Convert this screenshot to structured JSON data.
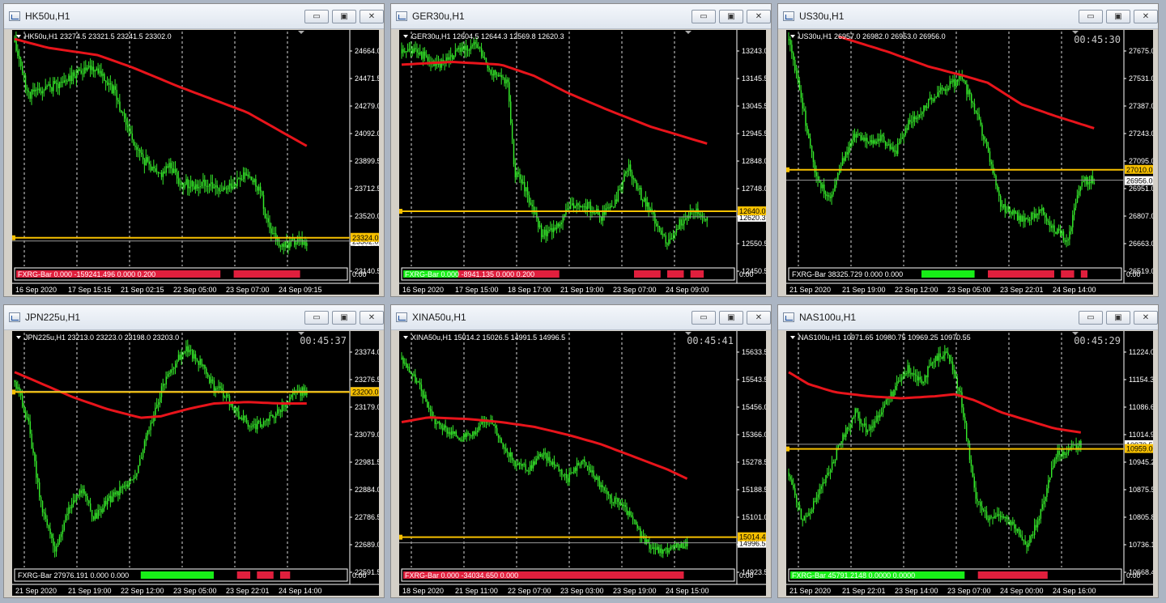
{
  "theme": {
    "candle": "#35e82a",
    "ma": "#e8141b",
    "hline": "#f7c000",
    "grid": "#ffffff",
    "bar_red": "#e01f3d",
    "bar_green": "#18ee18"
  },
  "window_buttons": {
    "minimize": "▭",
    "maximize": "▣",
    "close": "✕"
  },
  "charts": [
    {
      "id": "hk50",
      "window_title": "HK50u,H1",
      "header": "HK50u,H1  23274.5 23321.5 23241.5 23302.0",
      "timer": "",
      "price_ticks": [
        "24664.0",
        "24471.5",
        "24279.0",
        "24092.0",
        "23899.5",
        "23712.5",
        "23520.0",
        "23327.5",
        "23140.5"
      ],
      "time_labels": [
        "16 Sep 2020",
        "17 Sep 15:15",
        "21 Sep 02:15",
        "22 Sep 05:00",
        "23 Sep 07:00",
        "24 Sep 09:15"
      ],
      "ask_label": "23324.0",
      "bid_label": "23302.0",
      "indicator_label": "FXRG-Bar 0.000 -159241.496 0.000 0.200",
      "indicator_scale": "0.00",
      "ymin": 23140.5,
      "ymax": 24664.0,
      "ask": 23324.0,
      "bid": 23302.0,
      "path": [
        [
          0,
          24660
        ],
        [
          0.04,
          24300
        ],
        [
          0.08,
          24330
        ],
        [
          0.14,
          24380
        ],
        [
          0.2,
          24470
        ],
        [
          0.25,
          24480
        ],
        [
          0.3,
          24320
        ],
        [
          0.34,
          24080
        ],
        [
          0.38,
          23880
        ],
        [
          0.43,
          23750
        ],
        [
          0.47,
          23820
        ],
        [
          0.5,
          23700
        ],
        [
          0.54,
          23680
        ],
        [
          0.58,
          23710
        ],
        [
          0.62,
          23620
        ],
        [
          0.66,
          23700
        ],
        [
          0.7,
          23750
        ],
        [
          0.74,
          23640
        ],
        [
          0.76,
          23420
        ],
        [
          0.8,
          23260
        ],
        [
          0.84,
          23290
        ],
        [
          0.88,
          23290
        ]
      ],
      "ma": [
        [
          0,
          24680
        ],
        [
          0.1,
          24620
        ],
        [
          0.25,
          24570
        ],
        [
          0.35,
          24490
        ],
        [
          0.5,
          24350
        ],
        [
          0.7,
          24180
        ],
        [
          0.88,
          23950
        ]
      ],
      "candles": 190,
      "vol": 70,
      "seed": 11,
      "bars": [
        {
          "a": 0.005,
          "b": 0.62,
          "c": "red"
        },
        {
          "a": 0.66,
          "b": 0.86,
          "c": "red"
        }
      ]
    },
    {
      "id": "ger30",
      "window_title": "GER30u,H1",
      "header": "GER30u,H1  12604.5 12644.3 12569.8 12620.3",
      "timer": "",
      "price_ticks": [
        "13243.0",
        "13145.5",
        "13045.5",
        "12945.5",
        "12848.0",
        "12748.0",
        "12650.5",
        "12550.5",
        "12450.5"
      ],
      "time_labels": [
        "16 Sep 2020",
        "17 Sep 15:00",
        "18 Sep 17:00",
        "21 Sep 19:00",
        "23 Sep 07:00",
        "24 Sep 09:00"
      ],
      "ask_label": "12640.0",
      "bid_label": "12620.3",
      "indicator_label": "FXRG-Bar 0.000 -8941.135 0.000 0.200",
      "indicator_scale": "0.00",
      "ymin": 12450.5,
      "ymax": 13243.0,
      "ask": 12640.0,
      "bid": 12620.3,
      "path": [
        [
          0,
          13200
        ],
        [
          0.05,
          13210
        ],
        [
          0.1,
          13150
        ],
        [
          0.16,
          13200
        ],
        [
          0.22,
          13240
        ],
        [
          0.27,
          13140
        ],
        [
          0.32,
          13090
        ],
        [
          0.34,
          12780
        ],
        [
          0.38,
          12700
        ],
        [
          0.42,
          12560
        ],
        [
          0.46,
          12580
        ],
        [
          0.5,
          12650
        ],
        [
          0.56,
          12660
        ],
        [
          0.6,
          12620
        ],
        [
          0.64,
          12660
        ],
        [
          0.68,
          12800
        ],
        [
          0.72,
          12700
        ],
        [
          0.76,
          12620
        ],
        [
          0.8,
          12520
        ],
        [
          0.84,
          12600
        ],
        [
          0.88,
          12640
        ],
        [
          0.92,
          12620
        ]
      ],
      "ma": [
        [
          0,
          13160
        ],
        [
          0.15,
          13170
        ],
        [
          0.3,
          13160
        ],
        [
          0.4,
          13120
        ],
        [
          0.5,
          13060
        ],
        [
          0.62,
          13000
        ],
        [
          0.75,
          12940
        ],
        [
          0.92,
          12880
        ]
      ],
      "candles": 200,
      "vol": 35,
      "seed": 23,
      "bars": [
        {
          "a": 0.005,
          "b": 0.17,
          "c": "green"
        },
        {
          "a": 0.17,
          "b": 0.475,
          "c": "red"
        },
        {
          "a": 0.7,
          "b": 0.78,
          "c": "red"
        },
        {
          "a": 0.8,
          "b": 0.85,
          "c": "red"
        },
        {
          "a": 0.87,
          "b": 0.91,
          "c": "red"
        }
      ]
    },
    {
      "id": "us30",
      "window_title": "US30u,H1",
      "header": "US30u,H1  26957.0 26982.0 26953.0 26956.0",
      "timer": "00:45:30",
      "price_ticks": [
        "27675.0",
        "27531.0",
        "27387.0",
        "27243.0",
        "27095.0",
        "26951.0",
        "26807.0",
        "26663.0",
        "26519.0"
      ],
      "time_labels": [
        "21 Sep 2020",
        "21 Sep 19:00",
        "22 Sep 12:00",
        "23 Sep 05:00",
        "23 Sep 22:01",
        "24 Sep 14:00"
      ],
      "ask_label": "27010.0",
      "bid_label": "26956.0",
      "indicator_label": "FXRG-Bar 38325.729 0.000 0.000",
      "indicator_scale": "0.00",
      "ymin": 26519.0,
      "ymax": 27675.0,
      "ask": 27010.0,
      "bid": 26956.0,
      "path": [
        [
          0,
          27680
        ],
        [
          0.04,
          27350
        ],
        [
          0.08,
          27000
        ],
        [
          0.12,
          26850
        ],
        [
          0.16,
          27050
        ],
        [
          0.2,
          27200
        ],
        [
          0.24,
          27150
        ],
        [
          0.28,
          27180
        ],
        [
          0.32,
          27100
        ],
        [
          0.36,
          27250
        ],
        [
          0.4,
          27320
        ],
        [
          0.46,
          27430
        ],
        [
          0.52,
          27480
        ],
        [
          0.56,
          27330
        ],
        [
          0.6,
          27100
        ],
        [
          0.64,
          26820
        ],
        [
          0.7,
          26750
        ],
        [
          0.76,
          26800
        ],
        [
          0.8,
          26700
        ],
        [
          0.84,
          26650
        ],
        [
          0.88,
          26950
        ],
        [
          0.92,
          26960
        ]
      ],
      "ma": [
        [
          0.15,
          27700
        ],
        [
          0.3,
          27620
        ],
        [
          0.42,
          27545
        ],
        [
          0.52,
          27500
        ],
        [
          0.6,
          27460
        ],
        [
          0.7,
          27350
        ],
        [
          0.8,
          27290
        ],
        [
          0.92,
          27225
        ]
      ],
      "candles": 200,
      "vol": 45,
      "seed": 37,
      "bars": [
        {
          "a": 0.4,
          "b": 0.56,
          "c": "green"
        },
        {
          "a": 0.6,
          "b": 0.8,
          "c": "red"
        },
        {
          "a": 0.82,
          "b": 0.86,
          "c": "red"
        },
        {
          "a": 0.88,
          "b": 0.9,
          "c": "red"
        }
      ]
    },
    {
      "id": "jpn225",
      "window_title": "JPN225u,H1",
      "header": "JPN225u,H1  23213.0 23223.0 23198.0 23203.0",
      "timer": "00:45:37",
      "price_ticks": [
        "23374.0",
        "23276.5",
        "23179.0",
        "23079.0",
        "22981.5",
        "22884.0",
        "22786.5",
        "22689.0",
        "22591.5"
      ],
      "time_labels": [
        "21 Sep 2020",
        "21 Sep 19:00",
        "22 Sep 12:00",
        "23 Sep 05:00",
        "23 Sep 22:01",
        "24 Sep 14:00"
      ],
      "ask_label": "23200.0",
      "bid_label": "23203.0",
      "indicator_label": "FXRG-Bar 27976.191 0.000 0.000",
      "indicator_scale": "0.00",
      "ymin": 22591.5,
      "ymax": 23374.0,
      "ask": 23200.0,
      "bid": 23203.0,
      "path": [
        [
          0,
          23240
        ],
        [
          0.04,
          23100
        ],
        [
          0.08,
          22800
        ],
        [
          0.12,
          22650
        ],
        [
          0.16,
          22780
        ],
        [
          0.2,
          22860
        ],
        [
          0.24,
          22760
        ],
        [
          0.28,
          22820
        ],
        [
          0.32,
          22860
        ],
        [
          0.36,
          22900
        ],
        [
          0.4,
          23050
        ],
        [
          0.44,
          23200
        ],
        [
          0.48,
          23300
        ],
        [
          0.52,
          23350
        ],
        [
          0.56,
          23300
        ],
        [
          0.6,
          23220
        ],
        [
          0.64,
          23180
        ],
        [
          0.68,
          23110
        ],
        [
          0.72,
          23080
        ],
        [
          0.76,
          23100
        ],
        [
          0.8,
          23140
        ],
        [
          0.84,
          23200
        ],
        [
          0.88,
          23203
        ]
      ],
      "ma": [
        [
          0,
          23270
        ],
        [
          0.08,
          23230
        ],
        [
          0.18,
          23180
        ],
        [
          0.28,
          23140
        ],
        [
          0.38,
          23110
        ],
        [
          0.44,
          23115
        ],
        [
          0.52,
          23140
        ],
        [
          0.6,
          23160
        ],
        [
          0.7,
          23165
        ],
        [
          0.8,
          23160
        ],
        [
          0.88,
          23160
        ]
      ],
      "candles": 190,
      "vol": 30,
      "seed": 51,
      "bars": [
        {
          "a": 0.38,
          "b": 0.6,
          "c": "green"
        },
        {
          "a": 0.67,
          "b": 0.71,
          "c": "red"
        },
        {
          "a": 0.73,
          "b": 0.78,
          "c": "red"
        },
        {
          "a": 0.8,
          "b": 0.83,
          "c": "red"
        }
      ]
    },
    {
      "id": "xina50",
      "window_title": "XINA50u,H1",
      "header": "XINA50u,H1  15014.2 15026.5 14991.5 14996.5",
      "timer": "00:45:41",
      "price_ticks": [
        "15633.5",
        "15543.5",
        "15456.0",
        "15366.0",
        "15278.5",
        "15188.5",
        "15101.0",
        "15011.0",
        "14923.5"
      ],
      "time_labels": [
        "18 Sep 2020",
        "21 Sep 11:00",
        "22 Sep 07:00",
        "23 Sep 03:00",
        "23 Sep 19:00",
        "24 Sep 15:00"
      ],
      "ask_label": "15014.4",
      "bid_label": "14996.5",
      "indicator_label": "FXRG-Bar 0.000 -34034.650 0.000",
      "indicator_scale": "0.00",
      "ymin": 14923.5,
      "ymax": 15633.5,
      "ask": 15014.4,
      "bid": 14996.5,
      "path": [
        [
          0,
          15580
        ],
        [
          0.05,
          15500
        ],
        [
          0.1,
          15380
        ],
        [
          0.14,
          15350
        ],
        [
          0.18,
          15330
        ],
        [
          0.22,
          15340
        ],
        [
          0.26,
          15400
        ],
        [
          0.3,
          15320
        ],
        [
          0.34,
          15250
        ],
        [
          0.38,
          15230
        ],
        [
          0.42,
          15280
        ],
        [
          0.46,
          15250
        ],
        [
          0.5,
          15200
        ],
        [
          0.54,
          15260
        ],
        [
          0.58,
          15210
        ],
        [
          0.62,
          15140
        ],
        [
          0.66,
          15120
        ],
        [
          0.7,
          15060
        ],
        [
          0.74,
          14990
        ],
        [
          0.78,
          14970
        ],
        [
          0.82,
          14980
        ],
        [
          0.86,
          14995
        ]
      ],
      "ma": [
        [
          0,
          15380
        ],
        [
          0.08,
          15395
        ],
        [
          0.2,
          15390
        ],
        [
          0.3,
          15380
        ],
        [
          0.4,
          15365
        ],
        [
          0.5,
          15340
        ],
        [
          0.6,
          15310
        ],
        [
          0.7,
          15270
        ],
        [
          0.8,
          15230
        ],
        [
          0.86,
          15200
        ]
      ],
      "candles": 190,
      "vol": 25,
      "seed": 67,
      "bars": [
        {
          "a": 0.005,
          "b": 0.85,
          "c": "red"
        }
      ]
    },
    {
      "id": "nas100",
      "window_title": "NAS100u,H1",
      "header": "NAS100u,H1  10971.65 10980.75 10969.25 10970.55",
      "timer": "00:45:29",
      "price_ticks": [
        "11224.00",
        "11154.30",
        "11086.60",
        "11014.90",
        "10945.20",
        "10875.50",
        "10805.80",
        "10736.10",
        "10668.45"
      ],
      "time_labels": [
        "21 Sep 2020",
        "21 Sep 22:01",
        "23 Sep 14:00",
        "23 Sep 07:00",
        "24 Sep 00:00",
        "24 Sep 16:00"
      ],
      "ask_label": "10959.00",
      "bid_label": "10970.55",
      "indicator_label": "FXRG-Bar 45791.2148 0.0000 0.0000",
      "indicator_scale": "0.00",
      "ymin": 10668.45,
      "ymax": 11224.0,
      "ask": 10959.0,
      "bid": 10970.55,
      "path": [
        [
          0,
          10900
        ],
        [
          0.04,
          10780
        ],
        [
          0.08,
          10830
        ],
        [
          0.12,
          10900
        ],
        [
          0.16,
          10980
        ],
        [
          0.2,
          11050
        ],
        [
          0.24,
          11000
        ],
        [
          0.28,
          11060
        ],
        [
          0.32,
          11110
        ],
        [
          0.36,
          11160
        ],
        [
          0.4,
          11130
        ],
        [
          0.44,
          11180
        ],
        [
          0.48,
          11200
        ],
        [
          0.52,
          11080
        ],
        [
          0.56,
          10850
        ],
        [
          0.6,
          10780
        ],
        [
          0.64,
          10800
        ],
        [
          0.68,
          10760
        ],
        [
          0.72,
          10720
        ],
        [
          0.76,
          10800
        ],
        [
          0.8,
          10940
        ],
        [
          0.84,
          10960
        ],
        [
          0.88,
          10970
        ]
      ],
      "ma": [
        [
          0,
          11150
        ],
        [
          0.06,
          11120
        ],
        [
          0.14,
          11100
        ],
        [
          0.24,
          11090
        ],
        [
          0.34,
          11085
        ],
        [
          0.44,
          11090
        ],
        [
          0.5,
          11095
        ],
        [
          0.56,
          11080
        ],
        [
          0.64,
          11050
        ],
        [
          0.72,
          11030
        ],
        [
          0.8,
          11010
        ],
        [
          0.88,
          11000
        ]
      ],
      "candles": 190,
      "vol": 22,
      "seed": 83,
      "bars": [
        {
          "a": 0.005,
          "b": 0.53,
          "c": "green"
        },
        {
          "a": 0.57,
          "b": 0.78,
          "c": "red"
        }
      ]
    }
  ]
}
